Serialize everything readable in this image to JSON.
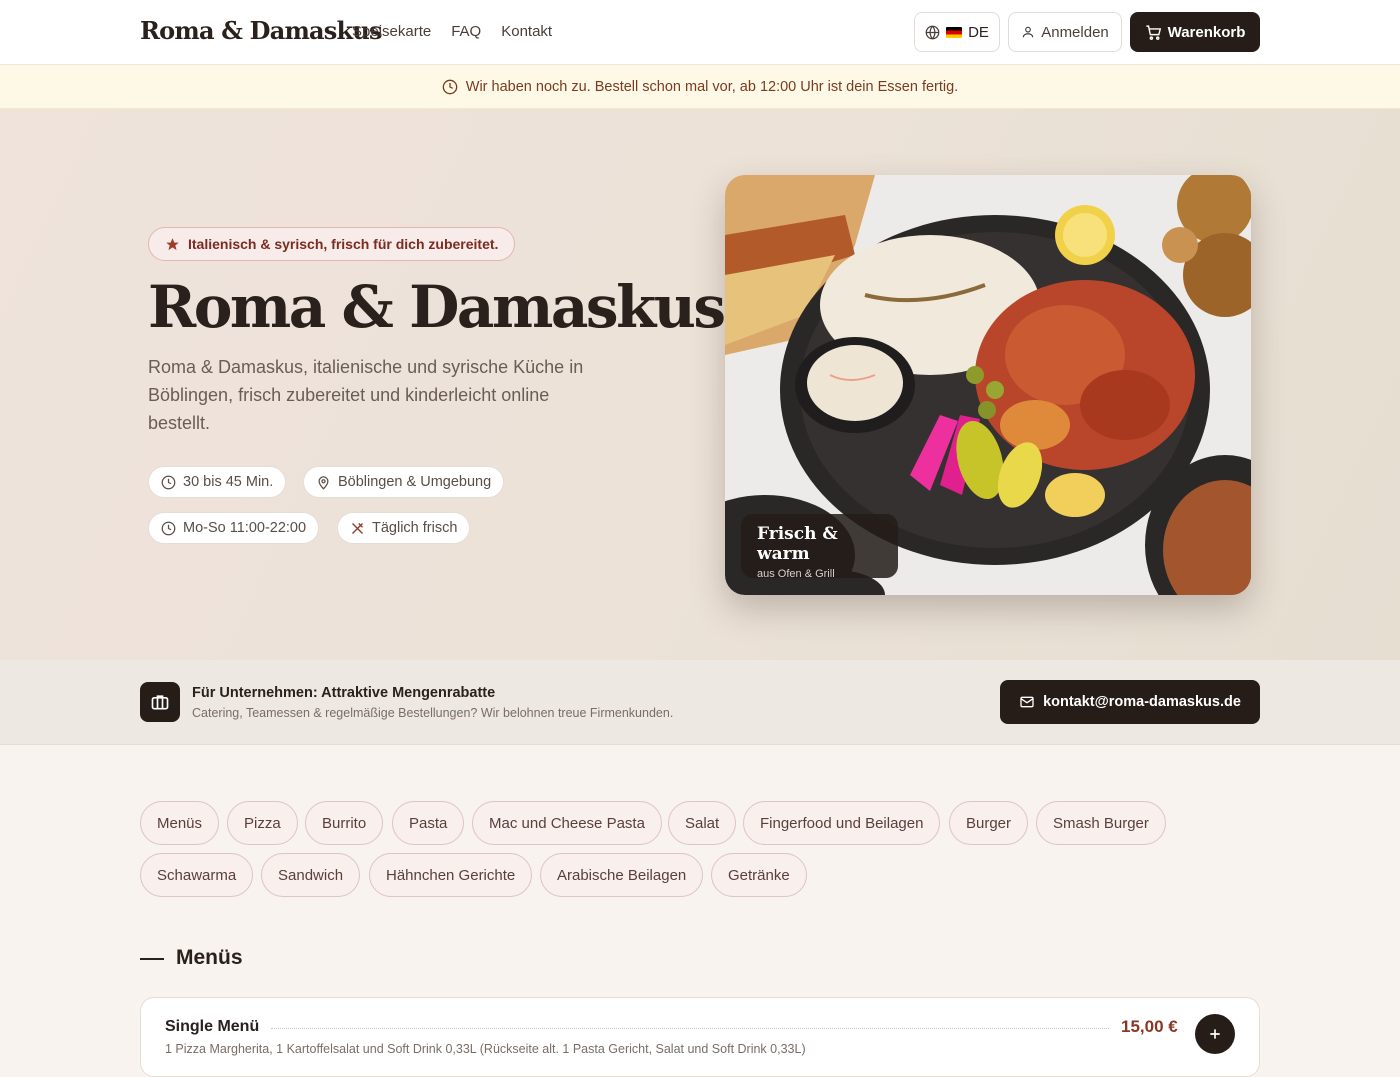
{
  "header": {
    "brand": "Roma & Damaskus",
    "nav": [
      "Speisekarte",
      "FAQ",
      "Kontakt"
    ],
    "language": "DE",
    "login_label": "Anmelden",
    "cart_label": "Warenkorb"
  },
  "notice": {
    "text": "Wir haben noch zu. Bestell schon mal vor, ab 12:00 Uhr ist dein Essen fertig."
  },
  "hero": {
    "tag": "Italienisch & syrisch, frisch für dich zubereitet.",
    "title": "Roma & Damaskus",
    "description": "Roma & Damaskus, italienische und syrische Küche in Böblingen, frisch zubereitet und kinderleicht online bestellt.",
    "chips": {
      "delivery_time": "30 bis 45 Min.",
      "area": "Böblingen & Umgebung",
      "hours": "Mo-So 11:00-22:00",
      "fresh": "Täglich frisch"
    },
    "image_badge": {
      "title": "Frisch & warm",
      "subtitle": "aus Ofen & Grill"
    }
  },
  "business": {
    "title": "Für Unternehmen: Attraktive Mengenrabatte",
    "subtitle": "Catering, Teamessen & regelmäßige Bestellungen? Wir belohnen treue Firmenkunden.",
    "email": "kontakt@roma-damaskus.de"
  },
  "categories": [
    "Menüs",
    "Pizza",
    "Burrito",
    "Pasta",
    "Mac und Cheese Pasta",
    "Salat",
    "Fingerfood und Beilagen",
    "Burger",
    "Smash Burger",
    "Schawarma",
    "Sandwich",
    "Hähnchen Gerichte",
    "Arabische Beilagen",
    "Getränke"
  ],
  "section": {
    "title": "Menüs"
  },
  "menu_items": [
    {
      "name": "Single Menü",
      "price": "15,00 €",
      "description": "1 Pizza Margherita, 1 Kartoffelsalat und Soft Drink 0,33L (Rückseite alt. 1 Pasta Gericht, Salat und Soft Drink 0,33L)"
    }
  ],
  "colors": {
    "dark": "#261d19",
    "accent": "#8c3624",
    "notice_bg": "#fdf9e6",
    "chip_border": "#dec4c2"
  },
  "icons": [
    "globe-icon",
    "user-icon",
    "cart-icon",
    "clock-icon",
    "star-icon",
    "pin-icon",
    "utensils-icon",
    "briefcase-icon",
    "mail-icon",
    "plus-icon"
  ]
}
